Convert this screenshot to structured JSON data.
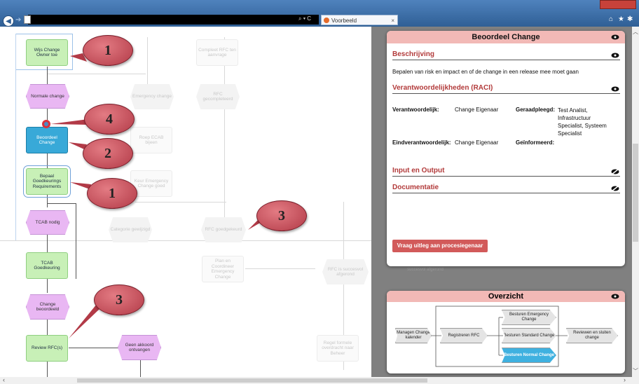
{
  "browser": {
    "address_search_icon": "⌕ ▾ C",
    "tab_title": "Voorbeeld",
    "tab_close": "×",
    "toolbar_icons": [
      "home-icon",
      "star-icon",
      "gear-icon"
    ],
    "window_controls": "‒ ▢ ✕"
  },
  "diagram": {
    "nodes": [
      {
        "id": "wijs-change-owner",
        "label": "Wijs Change Owner toe"
      },
      {
        "id": "normale-change",
        "label": "Normale change"
      },
      {
        "id": "beoordeel-change",
        "label": "Beoordeel Change"
      },
      {
        "id": "bepaal-goedkeurings",
        "label": "Bepaal Goedkeurings Requirements"
      },
      {
        "id": "tcab-nodig",
        "label": "TCAB nodig"
      },
      {
        "id": "tcab-goedkeuring",
        "label": "TCAB Goedkeuring"
      },
      {
        "id": "change-beoordeeld",
        "label": "Change beoordeeld"
      },
      {
        "id": "review-rfc",
        "label": "Review RFC(s)"
      },
      {
        "id": "geen-akkoord",
        "label": "Geen akkoord ontvangen"
      },
      {
        "id": "compleet-rfc",
        "label": "Compleet RFC ten aanvrage"
      },
      {
        "id": "rfc-gecompleteerd",
        "label": "RFC gecompleteerd"
      },
      {
        "id": "emergency-change",
        "label": "Emergency change"
      },
      {
        "id": "roep-ecab",
        "label": "Roep ECAB bijeen"
      },
      {
        "id": "keur-emergency",
        "label": "Keur Emergency Change goed"
      },
      {
        "id": "categorie-gewijzigd",
        "label": "Categorie gewijzigd"
      },
      {
        "id": "rfc-goedgekeurd",
        "label": "RFC goedgekeurd"
      },
      {
        "id": "plan-coordineer",
        "label": "Plan en Coordineer Emergency Change"
      },
      {
        "id": "rfc-succesvol",
        "label": "RFC is succesvol afgerond"
      },
      {
        "id": "afgerond",
        "label": "succesvol afgerond"
      },
      {
        "id": "regel-formele",
        "label": "Regel formele overdracht naar Beheer"
      }
    ],
    "callouts": [
      "1",
      "4",
      "2",
      "1",
      "3",
      "3"
    ]
  },
  "panel": {
    "title": "Beoordeel Change",
    "sections": {
      "beschrijving": {
        "heading": "Beschrijving",
        "text": "Bepalen van risk en impact en of de change in een release mee moet gaan"
      },
      "raci": {
        "heading": "Verantwoordelijkheden (RACI)",
        "verantwoordelijk_label": "Verantwoordelijk:",
        "verantwoordelijk_value": "Change Eigenaar",
        "geraadpleegd_label": "Geraadpleegd:",
        "geraadpleegd_value": "Test Analist, Infrastructuur Specialist, Systeem Specialist",
        "eindverantwoordelijk_label": "Eindverantwoordelijk:",
        "eindverantwoordelijk_value": "Change Eigenaar",
        "geinformeerd_label": "Geïnformeerd:"
      },
      "input_output": {
        "heading": "Input en Output"
      },
      "documentatie": {
        "heading": "Documentatie"
      }
    },
    "button": "Vraag uitleg aan procesiegenaar"
  },
  "overview": {
    "title": "Overzicht",
    "steps": {
      "managen": "Managen Change kalender",
      "registreren": "Registreren RFC",
      "emergency": "Besturen Emergency Change",
      "standaard": "Besturen Standard Change",
      "normale": "Besturen Normal Change",
      "reviewen": "Reviewen en sluiten change"
    }
  },
  "colors": {
    "accent_header": "#f2b9b6",
    "section_red": "#b23a3a",
    "button_red": "#d25a5a",
    "highlight_blue": "#38a9d8"
  }
}
